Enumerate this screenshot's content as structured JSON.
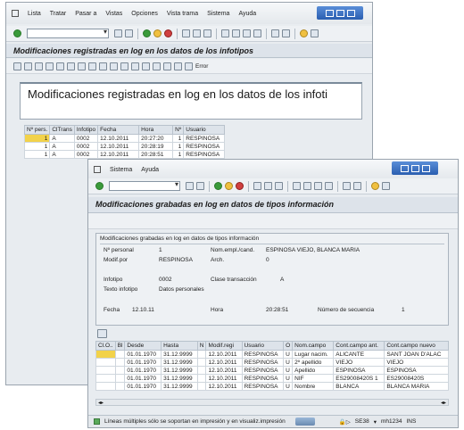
{
  "back_window": {
    "menu": [
      "Lista",
      "Tratar",
      "Pasar a",
      "Vistas",
      "Opciones",
      "Vista trama",
      "Sistema",
      "Ayuda"
    ],
    "title": "Modificaciones registradas en log en los datos de los infotipos",
    "big_text": "Modificaciones registradas en log en los datos de los infoti",
    "error_label": "Error",
    "table": {
      "headers": [
        "Nº pers.",
        "ClTrans",
        "Infotipo",
        "Fecha",
        "Hora",
        "Nº",
        "Usuario"
      ],
      "rows": [
        [
          "1",
          "A",
          "0002",
          "12.10.2011",
          "20:27:20",
          "1",
          "RESPINOSA"
        ],
        [
          "1",
          "A",
          "0002",
          "12.10.2011",
          "20:28:19",
          "1",
          "RESPINOSA"
        ],
        [
          "1",
          "A",
          "0002",
          "12.10.2011",
          "20:28:51",
          "1",
          "RESPINOSA"
        ]
      ]
    }
  },
  "front_window": {
    "menu": [
      "Sistema",
      "Ayuda"
    ],
    "title": "Modificaciones grabadas en log en datos de tipos información",
    "panel_header": "Modificaciones grabadas en log en datos de tipos información",
    "fields": {
      "personal_label": "Nº personal",
      "personal_value": "1",
      "nom_label": "Nom.empl./cand.",
      "nom_value": "ESPINOSA VIEJO, BLANCA MARIA",
      "modif_label": "Modif.por",
      "modif_value": "RESPINOSA",
      "arch_label": "Arch.",
      "arch_value": "0",
      "infotipo_label": "Infotipo",
      "infotipo_value": "0002",
      "clase_label": "Clase transacción",
      "clase_value": "A",
      "texto_label": "Texto infotipo",
      "texto_value": "Datos personales",
      "fecha_label": "Fecha",
      "fecha_value": "12.10.11",
      "hora_label": "Hora",
      "hora_value": "20:28:51",
      "secuencia_label": "Número de secuencia",
      "secuencia_value": "1"
    },
    "table": {
      "headers": [
        "Cl.O..",
        "Bl",
        "Desde",
        "Hasta",
        "N",
        "Modif.regi",
        "Usuario",
        "O",
        "Nom.campo",
        "Cont.campo ant.",
        "Cont.campo nuevo"
      ],
      "rows": [
        [
          "",
          "",
          "01.01.1970",
          "31.12.9999",
          "",
          "12.10.2011",
          "RESPINOSA",
          "U",
          "Lugar nacim.",
          "ALICANTE",
          "SANT JOAN D'ALAC"
        ],
        [
          "",
          "",
          "01.01.1970",
          "31.12.9999",
          "",
          "12.10.2011",
          "RESPINOSA",
          "U",
          "2º apellido",
          "VIEJO",
          "VIEJO"
        ],
        [
          "",
          "",
          "01.01.1970",
          "31.12.9999",
          "",
          "12.10.2011",
          "RESPINOSA",
          "U",
          "Apellido",
          "ESPINOSA",
          "ESPINOSA"
        ],
        [
          "",
          "",
          "01.01.1970",
          "31.12.9999",
          "",
          "12.10.2011",
          "RESPINOSA",
          "U",
          "NIF",
          "ES29008420S 1",
          "ES29008420S"
        ],
        [
          "",
          "",
          "01.01.1970",
          "31.12.9999",
          "",
          "12.10.2011",
          "RESPINOSA",
          "U",
          "Nombre",
          "BLANCA",
          "BLANCA MARIA"
        ]
      ]
    },
    "status": {
      "message": "Líneas múltiples sólo se soportan en impresión y en visualiz.impresión",
      "system": "SE38",
      "host": "mh1234",
      "mode": "INS"
    }
  }
}
